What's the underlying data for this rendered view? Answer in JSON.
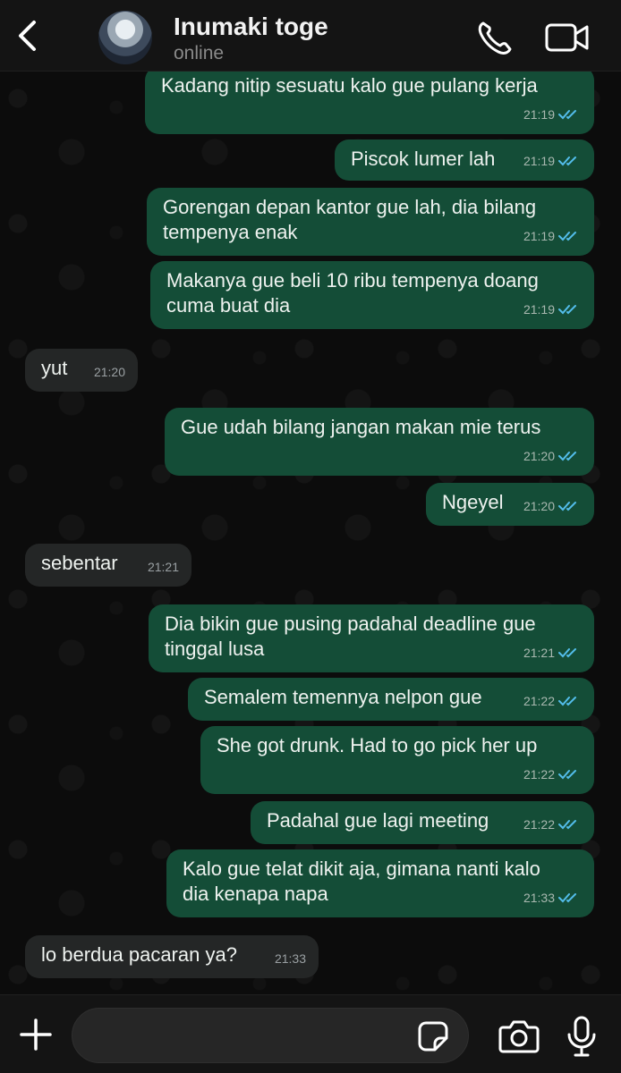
{
  "header": {
    "back_icon": "chevron-left-icon",
    "contact_name": "Inumaki toge",
    "status": "online",
    "call_icon": "phone-icon",
    "video_icon": "video-camera-icon"
  },
  "messages": [
    {
      "dir": "out",
      "text": "Kadang nitip sesuatu kalo gue pulang kerja",
      "time": "21:19"
    },
    {
      "dir": "out",
      "text": "Piscok lumer lah",
      "time": "21:19"
    },
    {
      "dir": "out",
      "text": "Gorengan depan kantor gue lah, dia bilang\ntempenya enak",
      "time": "21:19"
    },
    {
      "dir": "out",
      "text": "Makanya gue beli 10 ribu tempenya doang\ncuma buat dia",
      "time": "21:19"
    },
    {
      "dir": "in",
      "text": "yut",
      "time": "21:20"
    },
    {
      "dir": "out",
      "text": "Gue udah bilang jangan makan mie terus",
      "time": "21:20"
    },
    {
      "dir": "out",
      "text": "Ngeyel",
      "time": "21:20"
    },
    {
      "dir": "in",
      "text": "sebentar",
      "time": "21:21"
    },
    {
      "dir": "out",
      "text": "Dia bikin gue pusing padahal deadline gue\ntinggal lusa",
      "time": "21:21"
    },
    {
      "dir": "out",
      "text": "Semalem temennya nelpon gue",
      "time": "21:22"
    },
    {
      "dir": "out",
      "text": "She got drunk. Had to go pick her up",
      "time": "21:22"
    },
    {
      "dir": "out",
      "text": "Padahal gue lagi meeting",
      "time": "21:22"
    },
    {
      "dir": "out",
      "text": "Kalo gue telat dikit aja, gimana nanti kalo\ndia kenapa napa",
      "time": "21:33"
    },
    {
      "dir": "in",
      "text": "lo berdua pacaran ya?",
      "time": "21:33"
    }
  ],
  "composer": {
    "plus_icon": "plus-icon",
    "input_value": "",
    "sticker_icon": "sticker-icon",
    "camera_icon": "camera-icon",
    "mic_icon": "microphone-icon"
  },
  "colors": {
    "outgoing_bubble": "#144d37",
    "incoming_bubble": "#242626",
    "read_ticks": "#53bdeb",
    "background": "#0c0c0c"
  }
}
